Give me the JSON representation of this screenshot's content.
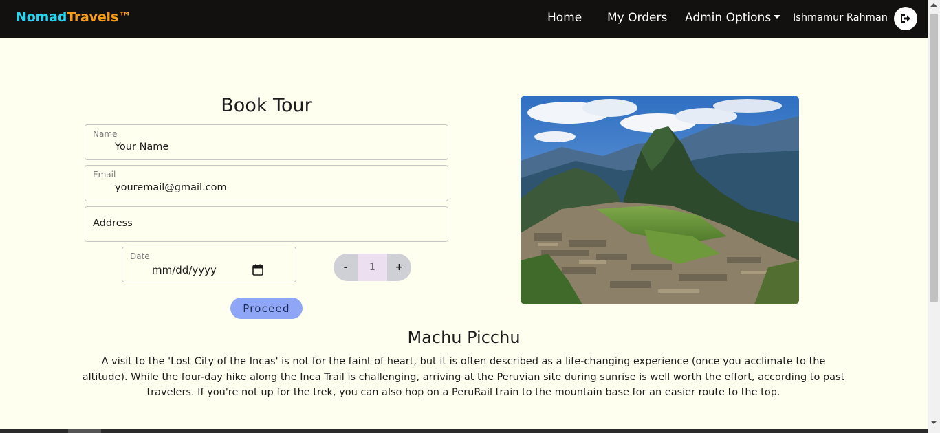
{
  "navbar": {
    "brand_part1": "Nomad",
    "brand_part2": "Travels™",
    "links": {
      "home": "Home",
      "orders": "My Orders",
      "admin": "Admin Options"
    },
    "user_name": "Ishmamur Rahman",
    "logout_icon": "sign-out-icon",
    "brand_colors": {
      "part1": "#26d4ee",
      "part2": "#f59c1a"
    }
  },
  "form": {
    "title": "Book Tour",
    "name": {
      "label": "Name",
      "value": "Your Name"
    },
    "email": {
      "label": "Email",
      "value": "youremail@gmail.com"
    },
    "address": {
      "placeholder": "Address"
    },
    "date": {
      "label": "Date",
      "value": "mm/dd/yyyy",
      "icon": "calendar-icon"
    },
    "quantity": {
      "minus": "-",
      "value": "1",
      "plus": "+"
    },
    "proceed_label": "Proceed",
    "proceed_color": "#8ea6f5"
  },
  "destination": {
    "name": "Machu Picchu",
    "description": "A visit to the 'Lost City of the Incas' is not for the faint of heart, but it is often described as a life-changing experience (once you acclimate to the altitude). While the four-day hike along the Inca Trail is challenging, arriving at the Peruvian site during sunrise is well worth the effort, according to past travelers. If you're not up for the trek, you can also hop on a PeruRail train to the mountain base for an easier route to the top."
  }
}
